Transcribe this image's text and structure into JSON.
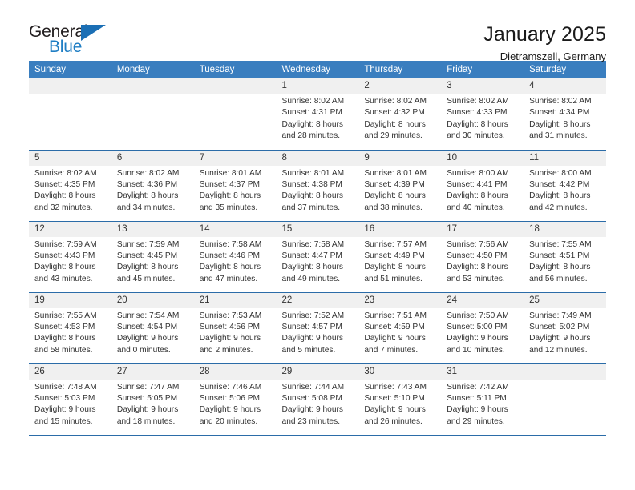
{
  "brand": {
    "name_part1": "General",
    "name_part2": "Blue",
    "triangle_color": "#1b6fb5"
  },
  "header": {
    "title": "January 2025",
    "location": "Dietramszell, Germany"
  },
  "theme": {
    "header_bg": "#3a7ebf",
    "week_divider": "#2b6ca8",
    "daynum_bg": "#f0f0f0",
    "text": "#333333"
  },
  "weekday_headers": [
    "Sunday",
    "Monday",
    "Tuesday",
    "Wednesday",
    "Thursday",
    "Friday",
    "Saturday"
  ],
  "labels": {
    "sunrise_prefix": "Sunrise:",
    "sunset_prefix": "Sunset:",
    "daylight_prefix": "Daylight:"
  },
  "weeks": [
    [
      {
        "day": "",
        "line1": "",
        "line2": "",
        "line3": "",
        "line4": ""
      },
      {
        "day": "",
        "line1": "",
        "line2": "",
        "line3": "",
        "line4": ""
      },
      {
        "day": "",
        "line1": "",
        "line2": "",
        "line3": "",
        "line4": ""
      },
      {
        "day": "1",
        "line1": "Sunrise: 8:02 AM",
        "line2": "Sunset: 4:31 PM",
        "line3": "Daylight: 8 hours",
        "line4": "and 28 minutes."
      },
      {
        "day": "2",
        "line1": "Sunrise: 8:02 AM",
        "line2": "Sunset: 4:32 PM",
        "line3": "Daylight: 8 hours",
        "line4": "and 29 minutes."
      },
      {
        "day": "3",
        "line1": "Sunrise: 8:02 AM",
        "line2": "Sunset: 4:33 PM",
        "line3": "Daylight: 8 hours",
        "line4": "and 30 minutes."
      },
      {
        "day": "4",
        "line1": "Sunrise: 8:02 AM",
        "line2": "Sunset: 4:34 PM",
        "line3": "Daylight: 8 hours",
        "line4": "and 31 minutes."
      }
    ],
    [
      {
        "day": "5",
        "line1": "Sunrise: 8:02 AM",
        "line2": "Sunset: 4:35 PM",
        "line3": "Daylight: 8 hours",
        "line4": "and 32 minutes."
      },
      {
        "day": "6",
        "line1": "Sunrise: 8:02 AM",
        "line2": "Sunset: 4:36 PM",
        "line3": "Daylight: 8 hours",
        "line4": "and 34 minutes."
      },
      {
        "day": "7",
        "line1": "Sunrise: 8:01 AM",
        "line2": "Sunset: 4:37 PM",
        "line3": "Daylight: 8 hours",
        "line4": "and 35 minutes."
      },
      {
        "day": "8",
        "line1": "Sunrise: 8:01 AM",
        "line2": "Sunset: 4:38 PM",
        "line3": "Daylight: 8 hours",
        "line4": "and 37 minutes."
      },
      {
        "day": "9",
        "line1": "Sunrise: 8:01 AM",
        "line2": "Sunset: 4:39 PM",
        "line3": "Daylight: 8 hours",
        "line4": "and 38 minutes."
      },
      {
        "day": "10",
        "line1": "Sunrise: 8:00 AM",
        "line2": "Sunset: 4:41 PM",
        "line3": "Daylight: 8 hours",
        "line4": "and 40 minutes."
      },
      {
        "day": "11",
        "line1": "Sunrise: 8:00 AM",
        "line2": "Sunset: 4:42 PM",
        "line3": "Daylight: 8 hours",
        "line4": "and 42 minutes."
      }
    ],
    [
      {
        "day": "12",
        "line1": "Sunrise: 7:59 AM",
        "line2": "Sunset: 4:43 PM",
        "line3": "Daylight: 8 hours",
        "line4": "and 43 minutes."
      },
      {
        "day": "13",
        "line1": "Sunrise: 7:59 AM",
        "line2": "Sunset: 4:45 PM",
        "line3": "Daylight: 8 hours",
        "line4": "and 45 minutes."
      },
      {
        "day": "14",
        "line1": "Sunrise: 7:58 AM",
        "line2": "Sunset: 4:46 PM",
        "line3": "Daylight: 8 hours",
        "line4": "and 47 minutes."
      },
      {
        "day": "15",
        "line1": "Sunrise: 7:58 AM",
        "line2": "Sunset: 4:47 PM",
        "line3": "Daylight: 8 hours",
        "line4": "and 49 minutes."
      },
      {
        "day": "16",
        "line1": "Sunrise: 7:57 AM",
        "line2": "Sunset: 4:49 PM",
        "line3": "Daylight: 8 hours",
        "line4": "and 51 minutes."
      },
      {
        "day": "17",
        "line1": "Sunrise: 7:56 AM",
        "line2": "Sunset: 4:50 PM",
        "line3": "Daylight: 8 hours",
        "line4": "and 53 minutes."
      },
      {
        "day": "18",
        "line1": "Sunrise: 7:55 AM",
        "line2": "Sunset: 4:51 PM",
        "line3": "Daylight: 8 hours",
        "line4": "and 56 minutes."
      }
    ],
    [
      {
        "day": "19",
        "line1": "Sunrise: 7:55 AM",
        "line2": "Sunset: 4:53 PM",
        "line3": "Daylight: 8 hours",
        "line4": "and 58 minutes."
      },
      {
        "day": "20",
        "line1": "Sunrise: 7:54 AM",
        "line2": "Sunset: 4:54 PM",
        "line3": "Daylight: 9 hours",
        "line4": "and 0 minutes."
      },
      {
        "day": "21",
        "line1": "Sunrise: 7:53 AM",
        "line2": "Sunset: 4:56 PM",
        "line3": "Daylight: 9 hours",
        "line4": "and 2 minutes."
      },
      {
        "day": "22",
        "line1": "Sunrise: 7:52 AM",
        "line2": "Sunset: 4:57 PM",
        "line3": "Daylight: 9 hours",
        "line4": "and 5 minutes."
      },
      {
        "day": "23",
        "line1": "Sunrise: 7:51 AM",
        "line2": "Sunset: 4:59 PM",
        "line3": "Daylight: 9 hours",
        "line4": "and 7 minutes."
      },
      {
        "day": "24",
        "line1": "Sunrise: 7:50 AM",
        "line2": "Sunset: 5:00 PM",
        "line3": "Daylight: 9 hours",
        "line4": "and 10 minutes."
      },
      {
        "day": "25",
        "line1": "Sunrise: 7:49 AM",
        "line2": "Sunset: 5:02 PM",
        "line3": "Daylight: 9 hours",
        "line4": "and 12 minutes."
      }
    ],
    [
      {
        "day": "26",
        "line1": "Sunrise: 7:48 AM",
        "line2": "Sunset: 5:03 PM",
        "line3": "Daylight: 9 hours",
        "line4": "and 15 minutes."
      },
      {
        "day": "27",
        "line1": "Sunrise: 7:47 AM",
        "line2": "Sunset: 5:05 PM",
        "line3": "Daylight: 9 hours",
        "line4": "and 18 minutes."
      },
      {
        "day": "28",
        "line1": "Sunrise: 7:46 AM",
        "line2": "Sunset: 5:06 PM",
        "line3": "Daylight: 9 hours",
        "line4": "and 20 minutes."
      },
      {
        "day": "29",
        "line1": "Sunrise: 7:44 AM",
        "line2": "Sunset: 5:08 PM",
        "line3": "Daylight: 9 hours",
        "line4": "and 23 minutes."
      },
      {
        "day": "30",
        "line1": "Sunrise: 7:43 AM",
        "line2": "Sunset: 5:10 PM",
        "line3": "Daylight: 9 hours",
        "line4": "and 26 minutes."
      },
      {
        "day": "31",
        "line1": "Sunrise: 7:42 AM",
        "line2": "Sunset: 5:11 PM",
        "line3": "Daylight: 9 hours",
        "line4": "and 29 minutes."
      },
      {
        "day": "",
        "line1": "",
        "line2": "",
        "line3": "",
        "line4": ""
      }
    ]
  ]
}
